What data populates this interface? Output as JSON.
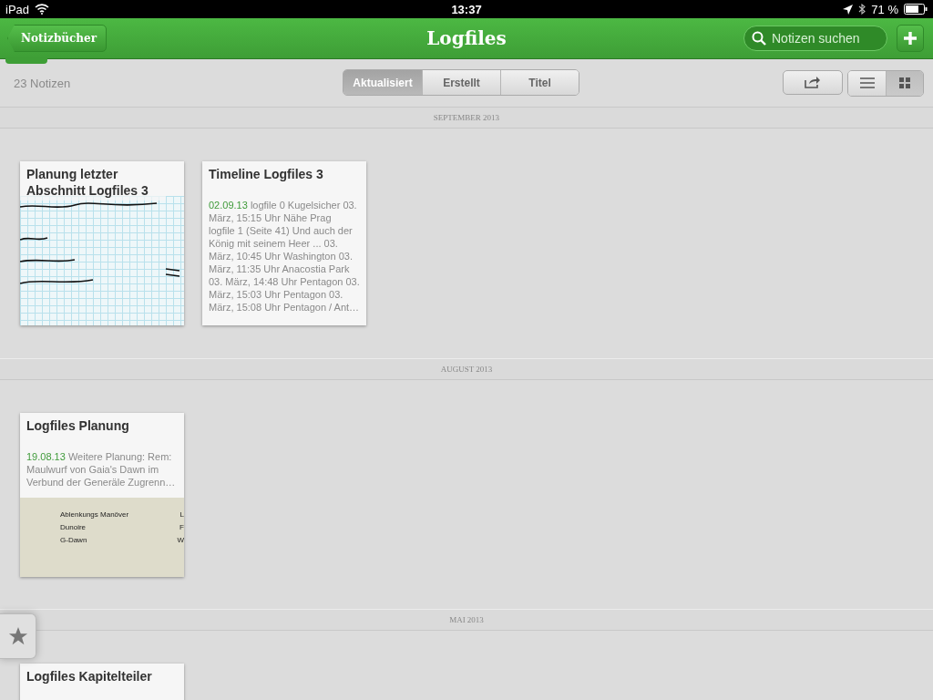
{
  "status_bar": {
    "device": "iPad",
    "time": "13:37",
    "battery": "71 %"
  },
  "header": {
    "back": "Notizbücher",
    "title": "Logfiles",
    "search": {
      "placeholder": "Notizen suchen"
    }
  },
  "toolbar": {
    "count": "23 Notizen",
    "sort_tabs": [
      {
        "label": "Aktualisiert",
        "selected": true
      },
      {
        "label": "Erstellt",
        "selected": false
      },
      {
        "label": "Titel",
        "selected": false
      }
    ],
    "views": [
      {
        "kind": "list",
        "selected": false
      },
      {
        "kind": "grid",
        "selected": true
      }
    ]
  },
  "sections": [
    {
      "label": "SEPTEMBER 2013",
      "notes": [
        {
          "kind": "handwriting",
          "title": "Planung letzter Abschnitt Logfiles 3"
        },
        {
          "kind": "text",
          "title": "Timeline Logfiles 3",
          "date": "02.09.13",
          "snippet": "logfile 0 Kugelsicher 03. März, 15:15 Uhr Nähe Prag logfile 1 (Seite 41) Und auch der König mit seinem Heer ... 03. März, 10:45 Uhr Washington 03. März, 11:35 Uhr Anacostia Park 03. März, 14:48 Uhr Pentagon 03. März, 15:03 Uhr Pentagon 03. März, 15:08 Uhr Pentagon / Ant…"
        }
      ]
    },
    {
      "label": "AUGUST 2013",
      "notes": [
        {
          "kind": "text-image",
          "title": "Logfiles Planung",
          "date": "19.08.13",
          "snippet": "Weitere Planung: Rem: Maulwurf von Gaia's Dawn im Verbund der Generäle Zugrenn…",
          "image_lines": [
            {
              "left": "Ablenkungs Manöver",
              "right": "L"
            },
            {
              "left": "Dunoire",
              "right": "F"
            },
            {
              "left": "G-Dawn",
              "right": "W"
            }
          ]
        }
      ]
    },
    {
      "label": "MAI 2013",
      "notes": [
        {
          "kind": "title-only",
          "title": "Logfiles Kapitelteiler"
        }
      ]
    }
  ]
}
